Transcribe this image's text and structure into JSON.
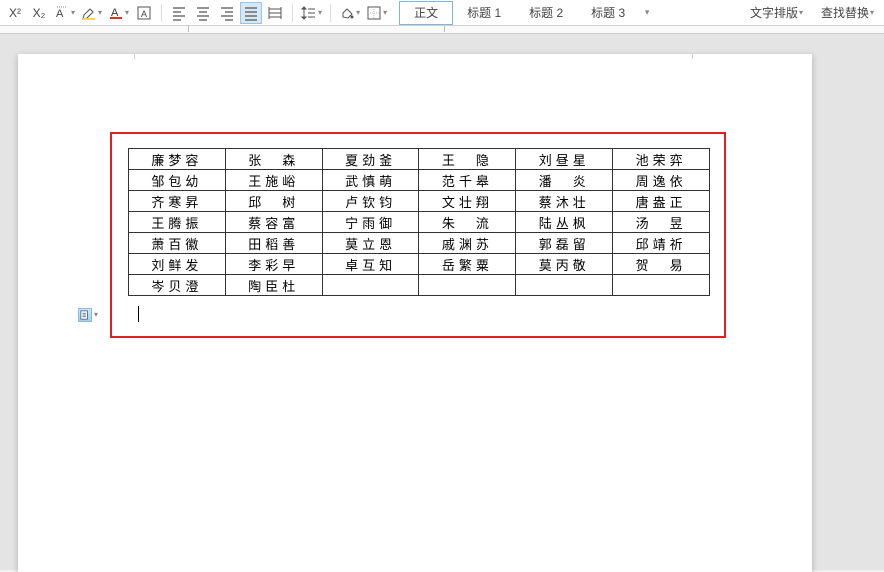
{
  "toolbar": {
    "superscript": "X²",
    "subscript": "X₂",
    "font_box": "A",
    "char_border": "A"
  },
  "styles": {
    "body": "正文",
    "h1": "标题 1",
    "h2": "标题 2",
    "h3": "标题 3"
  },
  "right": {
    "typeset": "文字排版",
    "find": "查找替换"
  },
  "table": {
    "rows": [
      [
        "廉梦容",
        "张　森",
        "夏劲釜",
        "王　隐",
        "刘昼星",
        "池荣弈"
      ],
      [
        "邹包幼",
        "王施峪",
        "武慎萌",
        "范千皋",
        "潘　炎",
        "周逸依"
      ],
      [
        "齐寒昇",
        "邱　树",
        "卢钦钧",
        "文壮翔",
        "蔡沐壮",
        "唐盎正"
      ],
      [
        "王腾振",
        "蔡容富",
        "宁雨御",
        "朱　流",
        "陆丛枫",
        "汤　昱"
      ],
      [
        "萧百徽",
        "田稻善",
        "莫立恩",
        "戚渊苏",
        "郭磊留",
        "邱靖祈"
      ],
      [
        "刘鲜发",
        "李彩早",
        "卓互知",
        "岳繁粟",
        "莫丙敬",
        "贺　易"
      ],
      [
        "岑贝澄",
        "陶臣杜",
        "",
        "",
        "",
        ""
      ]
    ]
  }
}
